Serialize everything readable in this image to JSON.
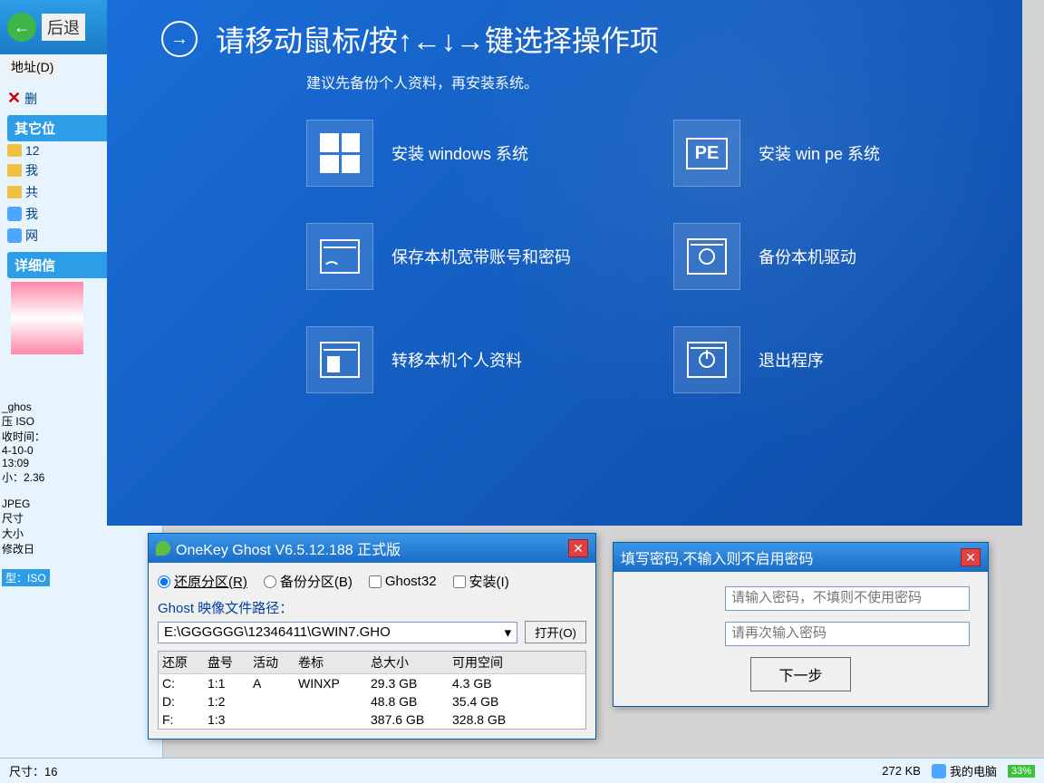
{
  "explorer": {
    "back_label": "后退",
    "addr_label": "地址(D)",
    "other_section": "其它位",
    "items": [
      "12",
      "我",
      "共",
      "我",
      "网"
    ],
    "delete_item": "删",
    "details_section": "详细信"
  },
  "left_strip": {
    "lines": [
      "_ghos",
      "压 ISO",
      "收时间：",
      "4-10-0",
      "13:09",
      "小：2.36",
      "JPEG",
      "尺寸",
      "大小",
      "修改日"
    ],
    "iso_tag": "型：ISO",
    "size_label": "尺寸：16"
  },
  "installer": {
    "title": "请移动鼠标/按↑←↓→键选择操作项",
    "subtitle": "建议先备份个人资料，再安装系统。",
    "tiles": [
      {
        "label": "安装 windows 系统",
        "icon": "windows"
      },
      {
        "label": "安装 win pe 系统",
        "icon": "pe"
      },
      {
        "label": "保存本机宽带账号和密码",
        "icon": "browser"
      },
      {
        "label": "备份本机驱动",
        "icon": "gear"
      },
      {
        "label": "转移本机个人资料",
        "icon": "doc"
      },
      {
        "label": "退出程序",
        "icon": "power"
      }
    ]
  },
  "ghost": {
    "title": "OneKey Ghost V6.5.12.188 正式版",
    "radio_restore": "还原分区(R)",
    "radio_backup": "备份分区(B)",
    "chk_ghost32": "Ghost32",
    "chk_install": "安装(I)",
    "path_label": "Ghost 映像文件路径：",
    "path_value": "E:\\GGGGGG\\12346411\\GWIN7.GHO",
    "open_btn": "打开(O)",
    "columns": [
      "还原",
      "盘号",
      "活动",
      "卷标",
      "总大小",
      "可用空间"
    ],
    "rows": [
      {
        "drive": "C:",
        "num": "1:1",
        "active": "A",
        "label": "WINXP",
        "total": "29.3 GB",
        "free": "4.3 GB"
      },
      {
        "drive": "D:",
        "num": "1:2",
        "active": "",
        "label": "",
        "total": "48.8 GB",
        "free": "35.4 GB"
      },
      {
        "drive": "F:",
        "num": "1:3",
        "active": "",
        "label": "",
        "total": "387.6 GB",
        "free": "328.8 GB"
      }
    ]
  },
  "pwd": {
    "title": "填写密码,不输入则不启用密码",
    "ph1": "请输入密码，不填则不使用密码",
    "ph2": "请再次输入密码",
    "next": "下一步"
  },
  "status": {
    "size": "272 KB",
    "computer": "我的电脑",
    "pct": "33%"
  }
}
